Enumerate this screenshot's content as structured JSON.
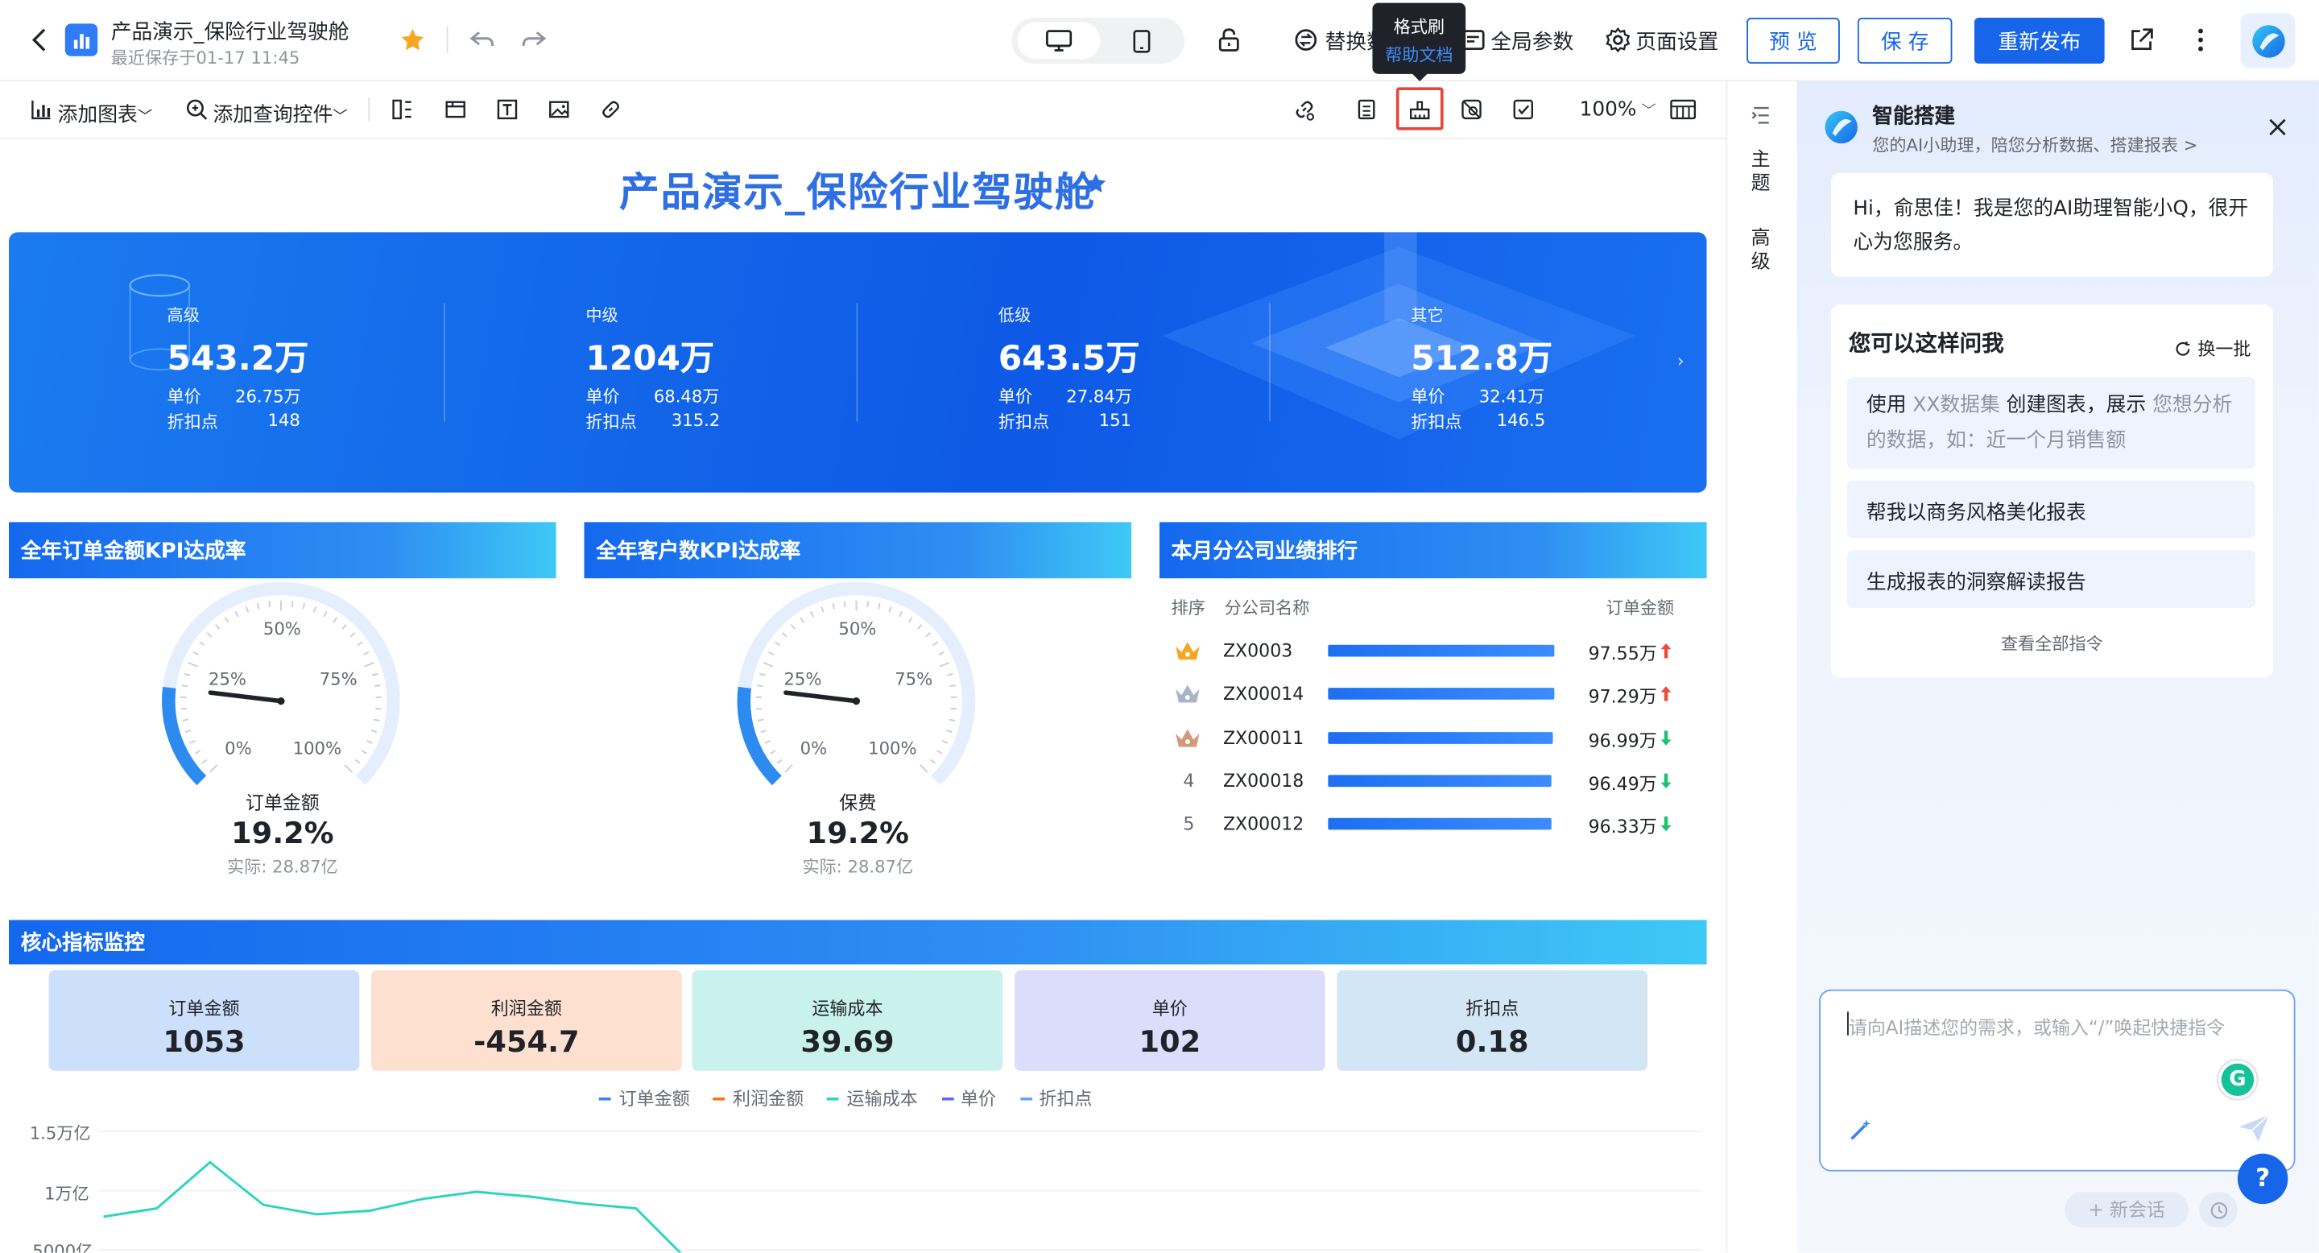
{
  "header": {
    "doc_title": "产品演示_保险行业驾驶舱",
    "saved_at": "最近保存于01-17 11:45",
    "replace_label": "替换数",
    "global_params": "全局参数",
    "page_settings": "页面设置",
    "preview": "预 览",
    "save": "保 存",
    "republish": "重新发布"
  },
  "tooltip": {
    "title": "格式刷",
    "link": "帮助文档"
  },
  "toolbar": {
    "add_chart": "添加图表",
    "add_query": "添加查询控件",
    "zoom": "100%"
  },
  "dashboard": {
    "title": "产品演示_保险行业驾驶舱",
    "kpis": [
      {
        "level": "高级",
        "value": "543.2万",
        "price_label": "单价",
        "price": "26.75万",
        "discount_label": "折扣点",
        "discount": "148"
      },
      {
        "level": "中级",
        "value": "1204万",
        "price_label": "单价",
        "price": "68.48万",
        "discount_label": "折扣点",
        "discount": "315.2"
      },
      {
        "level": "低级",
        "value": "643.5万",
        "price_label": "单价",
        "price": "27.84万",
        "discount_label": "折扣点",
        "discount": "151"
      },
      {
        "level": "其它",
        "value": "512.8万",
        "price_label": "单价",
        "price": "32.41万",
        "discount_label": "折扣点",
        "discount": "146.5"
      }
    ],
    "gauge1": {
      "title": "全年订单金额KPI达成率",
      "ticks": [
        "0%",
        "25%",
        "50%",
        "75%",
        "100%"
      ],
      "name": "订单金额",
      "percent": "19.2%",
      "actual": "实际: 28.87亿",
      "fraction": 0.192
    },
    "gauge2": {
      "title": "全年客户数KPI达成率",
      "ticks": [
        "0%",
        "25%",
        "50%",
        "75%",
        "100%"
      ],
      "name": "保费",
      "percent": "19.2%",
      "actual": "实际: 28.87亿",
      "fraction": 0.192
    },
    "ranking": {
      "title": "本月分公司业绩排行",
      "col_rank": "排序",
      "col_name": "分公司名称",
      "col_amount": "订单金额",
      "rows": [
        {
          "rank": "1",
          "name": "ZX0003",
          "amount": "97.55万",
          "value": 97.55,
          "trend": "up"
        },
        {
          "rank": "2",
          "name": "ZX00014",
          "amount": "97.29万",
          "value": 97.29,
          "trend": "up"
        },
        {
          "rank": "3",
          "name": "ZX00011",
          "amount": "96.99万",
          "value": 96.99,
          "trend": "down"
        },
        {
          "rank": "4",
          "name": "ZX00018",
          "amount": "96.49万",
          "value": 96.49,
          "trend": "down"
        },
        {
          "rank": "5",
          "name": "ZX00012",
          "amount": "96.33万",
          "value": 96.33,
          "trend": "down"
        }
      ]
    },
    "monitor": {
      "title": "核心指标监控",
      "metrics": [
        {
          "label": "订单金额",
          "value": "1053",
          "color": "#cde0fb"
        },
        {
          "label": "利润金额",
          "value": "-454.7",
          "color": "#fde0cf"
        },
        {
          "label": "运输成本",
          "value": "39.69",
          "color": "#c9f1ee"
        },
        {
          "label": "单价",
          "value": "102",
          "color": "#dcdcfb"
        },
        {
          "label": "折扣点",
          "value": "0.18",
          "color": "#d3e6f6"
        }
      ],
      "legend": [
        "订单金额",
        "利润金额",
        "运输成本",
        "单价",
        "折扣点"
      ],
      "legend_colors": [
        "#3b82f6",
        "#f97316",
        "#2dd4bf",
        "#6366f1",
        "#60a5fa"
      ]
    }
  },
  "chart_data": {
    "type": "line",
    "yticks": [
      "1.5万亿",
      "1万亿",
      "5000亿"
    ],
    "series": [
      {
        "name": "运输成本",
        "values": [
          0.78,
          0.85,
          1.24,
          0.88,
          0.8,
          0.83,
          0.93,
          0.99,
          0.95,
          0.89,
          0.85,
          0.4
        ]
      }
    ]
  },
  "side_strip": {
    "theme": "主题",
    "advanced": "高级"
  },
  "ai": {
    "title": "智能搭建",
    "subtitle": "您的AI小助理，陪您分析数据、搭建报表 >",
    "greeting": "Hi，俞思佳！我是您的AI助理智能小Q，很开心为您服务。",
    "ask_title": "您可以这样问我",
    "refresh": "换一批",
    "suggestions": [
      "使用 XX数据集 创建图表，展示 您想分析的数据，如：近一个月销售额",
      "帮我以商务风格美化报表",
      "生成报表的洞察解读报告"
    ],
    "view_all": "查看全部指令",
    "input_placeholder": "请向AI描述您的需求，或输入“/”唤起快捷指令",
    "new_chat": "+ 新会话"
  }
}
